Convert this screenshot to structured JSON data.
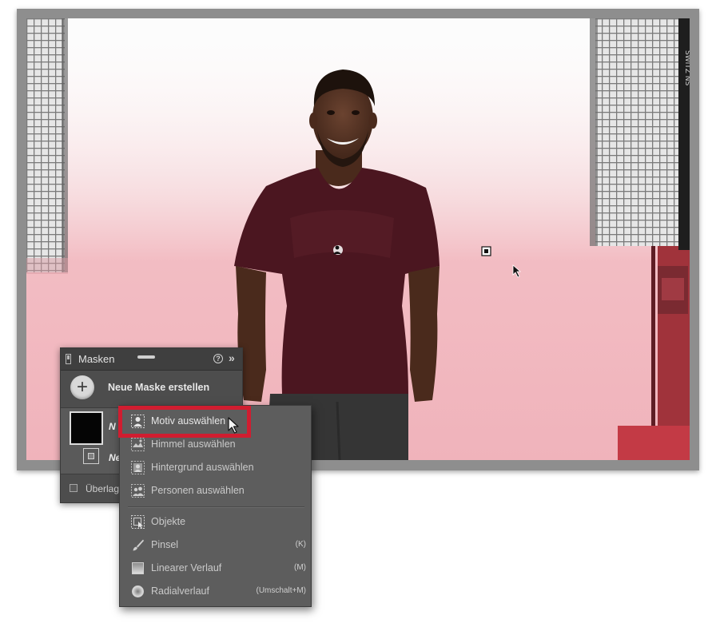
{
  "masks_panel": {
    "title": "Masken",
    "help_glyph": "?",
    "expand_glyph": "»",
    "create_button_glyph": "+",
    "create_label": "Neue Maske erstellen",
    "mask_name_visible": "N",
    "submask_name_visible": "Ne",
    "overlay_label_visible": "Überlag",
    "overlay_checked": false
  },
  "popup_menu": {
    "items": [
      {
        "label": "Motiv auswählen",
        "icon": "person-select-icon",
        "highlighted": true
      },
      {
        "label": "Himmel auswählen",
        "icon": "sky-select-icon"
      },
      {
        "label": "Hintergrund auswählen",
        "icon": "background-select-icon"
      },
      {
        "label": "Personen auswählen",
        "icon": "people-select-icon"
      },
      {
        "label": "Objekte",
        "icon": "objects-icon"
      },
      {
        "label": "Pinsel",
        "icon": "brush-icon",
        "shortcut": "(K)"
      },
      {
        "label": "Linearer Verlauf",
        "icon": "linear-gradient-icon",
        "shortcut": "(M)"
      },
      {
        "label": "Radialverlauf",
        "icon": "radial-gradient-icon",
        "shortcut": "(Umschalt+M)"
      }
    ]
  },
  "colors": {
    "highlight_border": "#d01d30",
    "mask_overlay": "#e9969f",
    "panel_bg": "#4d4d4d",
    "menu_bg": "#5d5d5d",
    "shirt": "#4b1620"
  },
  "photo": {
    "softbox_brand_text": "SWITZ NS"
  }
}
